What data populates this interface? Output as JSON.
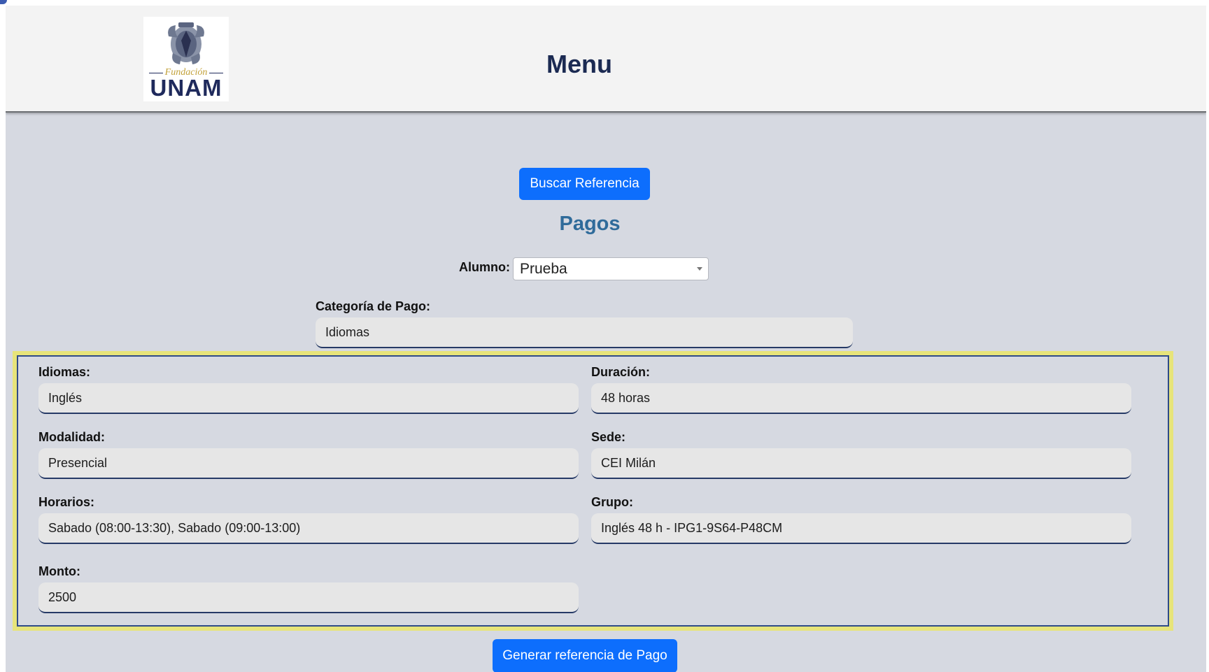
{
  "header": {
    "logo_top": "Fundación",
    "logo_bottom": "UNAM",
    "title": "Menu"
  },
  "actions": {
    "search_reference": "Buscar Referencia",
    "generate_reference": "Generar referencia de Pago"
  },
  "section_title": "Pagos",
  "student": {
    "label": "Alumno:",
    "selected": "Prueba"
  },
  "payment_category": {
    "label": "Categoría de Pago:",
    "value": "Idiomas"
  },
  "details": {
    "language": {
      "label": "Idiomas:",
      "value": "Inglés"
    },
    "duration": {
      "label": "Duración:",
      "value": "48 horas"
    },
    "modality": {
      "label": "Modalidad:",
      "value": "Presencial"
    },
    "campus": {
      "label": "Sede:",
      "value": "CEI Milán"
    },
    "schedule": {
      "label": "Horarios:",
      "value": "Sabado (08:00-13:30), Sabado (09:00-13:00)"
    },
    "group": {
      "label": "Grupo:",
      "value": "Inglés 48 h - IPG1-9S64-P48CM"
    },
    "amount": {
      "label": "Monto:",
      "value": "2500"
    }
  },
  "colors": {
    "primary_button": "#0d6efd",
    "page_background": "#d6d9e1",
    "panel_border": "#e7e47a",
    "heading_blue": "#2f6b9a"
  }
}
